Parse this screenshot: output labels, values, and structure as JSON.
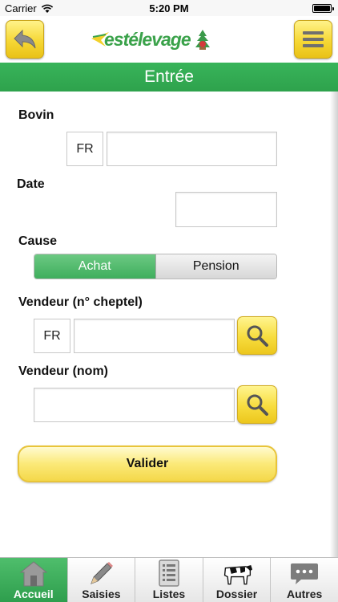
{
  "status": {
    "carrier": "Carrier",
    "time": "5:20 PM"
  },
  "header": {
    "logo_text": "estélevage"
  },
  "page": {
    "title": "Entrée"
  },
  "form": {
    "bovin": {
      "label": "Bovin",
      "prefix": "FR",
      "value": ""
    },
    "date": {
      "label": "Date",
      "value": ""
    },
    "cause": {
      "label": "Cause",
      "options": [
        "Achat",
        "Pension"
      ],
      "selected": "Achat"
    },
    "vendeur_cheptel": {
      "label": "Vendeur (n° cheptel)",
      "prefix": "FR",
      "value": ""
    },
    "vendeur_nom": {
      "label": "Vendeur (nom)",
      "value": ""
    },
    "submit_label": "Valider"
  },
  "tabs": [
    {
      "label": "Accueil",
      "icon": "house-icon",
      "active": true
    },
    {
      "label": "Saisies",
      "icon": "pencil-icon",
      "active": false
    },
    {
      "label": "Listes",
      "icon": "list-icon",
      "active": false
    },
    {
      "label": "Dossier",
      "icon": "cow-icon",
      "active": false
    },
    {
      "label": "Autres",
      "icon": "chat-icon",
      "active": false
    }
  ],
  "colors": {
    "brand_green": "#2ea24c",
    "button_yellow": "#f6d735"
  }
}
